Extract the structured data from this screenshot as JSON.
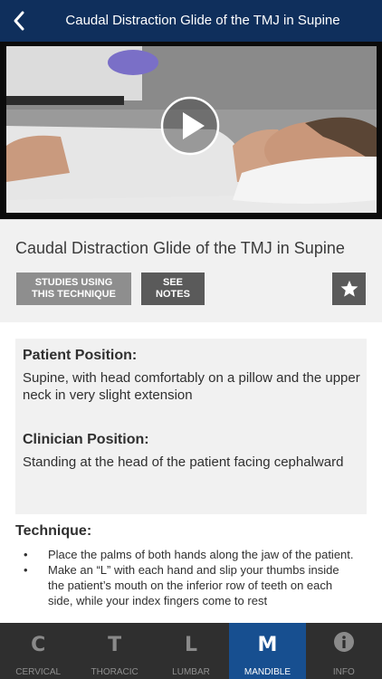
{
  "header": {
    "title": "Caudal Distraction Glide of the TMJ in Supine"
  },
  "technique": {
    "title": "Caudal Distraction Glide of the TMJ in Supine",
    "buttons": {
      "studies": "STUDIES USING THIS TECHNIQUE",
      "notes": "SEE NOTES"
    },
    "patient_position_heading": "Patient Position:",
    "patient_position": "Supine, with head comfortably on a pillow and the upper neck in very slight extension",
    "clinician_position_heading": "Clinician Position:",
    "clinician_position": "Standing at the head of the patient facing cephalward",
    "technique_heading": "Technique:",
    "steps": [
      "Place the palms of both hands along the jaw of the patient.",
      "Make an “L” with each hand and slip your thumbs inside the patient’s mouth on the inferior row of teeth on each side, while your index fingers come to rest"
    ]
  },
  "tabs": [
    {
      "glyph": "C",
      "label": "CERVICAL",
      "active": false
    },
    {
      "glyph": "T",
      "label": "THORACIC",
      "active": false
    },
    {
      "glyph": "L",
      "label": "LUMBAR",
      "active": false
    },
    {
      "glyph": "M",
      "label": "MANDIBLE",
      "active": true
    },
    {
      "glyph": "i",
      "label": "INFO",
      "active": false
    }
  ],
  "colors": {
    "navbar": "#0f2f5c",
    "tab_active": "#174f90",
    "tabbar": "#2f2f2f"
  }
}
